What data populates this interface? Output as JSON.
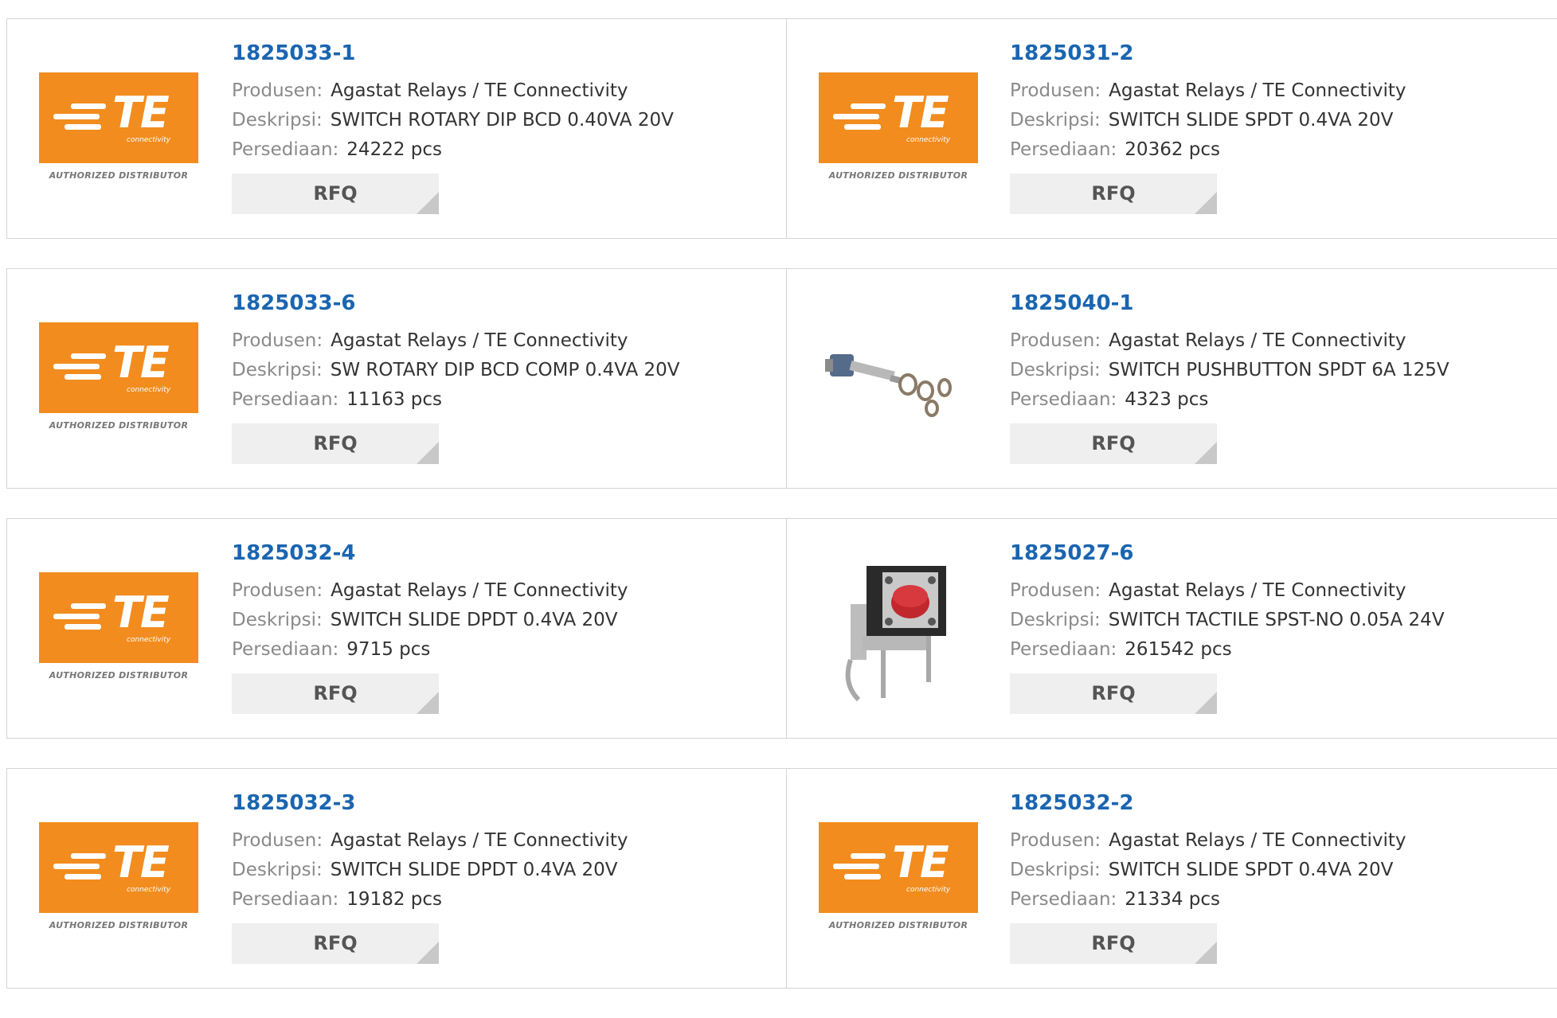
{
  "labels": {
    "manufacturer": "Produsen:",
    "description": "Deskripsi:",
    "stock": "Persediaan:",
    "rfq": "RFQ"
  },
  "logo": {
    "letters": "TE",
    "sub": "connectivity",
    "authorized": "AUTHORIZED DISTRIBUTOR"
  },
  "products": [
    {
      "pn": "1825033-1",
      "manufacturer": "Agastat Relays / TE Connectivity",
      "description": "SWITCH ROTARY DIP BCD 0.40VA 20V",
      "stock": "24222 pcs",
      "image": "te-logo"
    },
    {
      "pn": "1825031-2",
      "manufacturer": "Agastat Relays / TE Connectivity",
      "description": "SWITCH SLIDE SPDT 0.4VA 20V",
      "stock": "20362 pcs",
      "image": "te-logo"
    },
    {
      "pn": "1825033-6",
      "manufacturer": "Agastat Relays / TE Connectivity",
      "description": "SW ROTARY DIP BCD COMP 0.4VA 20V",
      "stock": "11163 pcs",
      "image": "te-logo"
    },
    {
      "pn": "1825040-1",
      "manufacturer": "Agastat Relays / TE Connectivity",
      "description": "SWITCH PUSHBUTTON SPDT 6A 125V",
      "stock": "4323 pcs",
      "image": "pushbutton-photo"
    },
    {
      "pn": "1825032-4",
      "manufacturer": "Agastat Relays / TE Connectivity",
      "description": "SWITCH SLIDE DPDT 0.4VA 20V",
      "stock": "9715 pcs",
      "image": "te-logo"
    },
    {
      "pn": "1825027-6",
      "manufacturer": "Agastat Relays / TE Connectivity",
      "description": "SWITCH TACTILE SPST-NO 0.05A 24V",
      "stock": "261542 pcs",
      "image": "tactile-photo"
    },
    {
      "pn": "1825032-3",
      "manufacturer": "Agastat Relays / TE Connectivity",
      "description": "SWITCH SLIDE DPDT 0.4VA 20V",
      "stock": "19182 pcs",
      "image": "te-logo"
    },
    {
      "pn": "1825032-2",
      "manufacturer": "Agastat Relays / TE Connectivity",
      "description": "SWITCH SLIDE SPDT 0.4VA 20V",
      "stock": "21334 pcs",
      "image": "te-logo"
    }
  ],
  "colors": {
    "brand_orange": "#f28c1f",
    "link_blue": "#1a65b0"
  }
}
